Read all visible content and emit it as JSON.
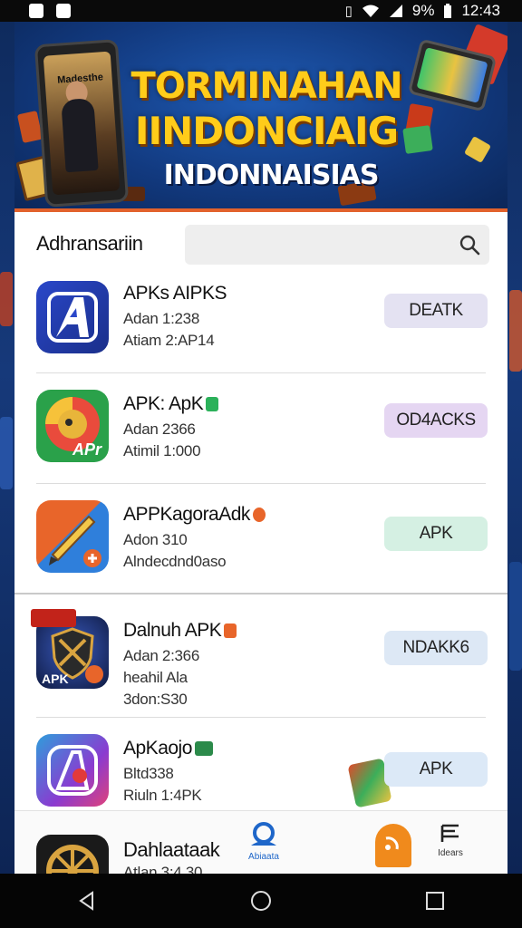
{
  "status_bar": {
    "time": "12:43",
    "battery": "9%"
  },
  "banner": {
    "title_line1": "TORMINAHAN",
    "title_line2": "IINDONCIAIG",
    "subtitle": "INDONNAISIAS",
    "phone_text": "Madesthe"
  },
  "section": {
    "title": "Adhransariin",
    "search_placeholder": ""
  },
  "apps": [
    {
      "name": "APKs AIPKS",
      "meta1": "Adan 1:238",
      "meta2": "Atiam 2:AP14",
      "meta3": "",
      "button": "DEATK",
      "button_color": "#e4e2f2",
      "icon_color": "#2a47c9"
    },
    {
      "name": "APK: ApK",
      "meta1": "Adan 2366",
      "meta2": "Atimil 1:000",
      "meta3": "",
      "button": "OD4ACKS",
      "button_color": "#e5d6f2",
      "icon_color": "#2aa14a"
    },
    {
      "name": "APPKagoraAdk",
      "meta1": "Adon 310",
      "meta2": "Alndecdnd0aso",
      "meta3": "",
      "button": "APK",
      "button_color": "#d5f0e3",
      "icon_color": "#2f7fdb"
    },
    {
      "name": "Dalnuh APK",
      "meta1": "Adan 2:366",
      "meta2": "heahil Ala",
      "meta3": "3don:S30",
      "button": "NDAKK6",
      "button_color": "#dde8f5",
      "icon_color": "#1b2a5a"
    },
    {
      "name": "ApKaojo",
      "meta1": "Bltd338",
      "meta2": "Riuln 1:4PK",
      "meta3": "",
      "button": "APK",
      "button_color": "#dce9f7",
      "icon_color": "#5a4fd8"
    },
    {
      "name": "Dahlaataak",
      "meta1": "Atlan 3:4 30",
      "meta2": "",
      "meta3": "",
      "button": "",
      "button_color": "#ffffff",
      "icon_color": "#1a1a1a"
    }
  ],
  "bottom_nav": {
    "item1_label": "Abiaata",
    "item3_label": "Idears"
  },
  "icons": [
    "search-icon",
    "wifi-icon",
    "signal-icon",
    "battery-icon",
    "back-icon",
    "home-icon",
    "recents-icon"
  ],
  "colors": {
    "banner_bg": "#123a80",
    "banner_title": "#ffcc1a",
    "accent_line": "#e2622c"
  }
}
